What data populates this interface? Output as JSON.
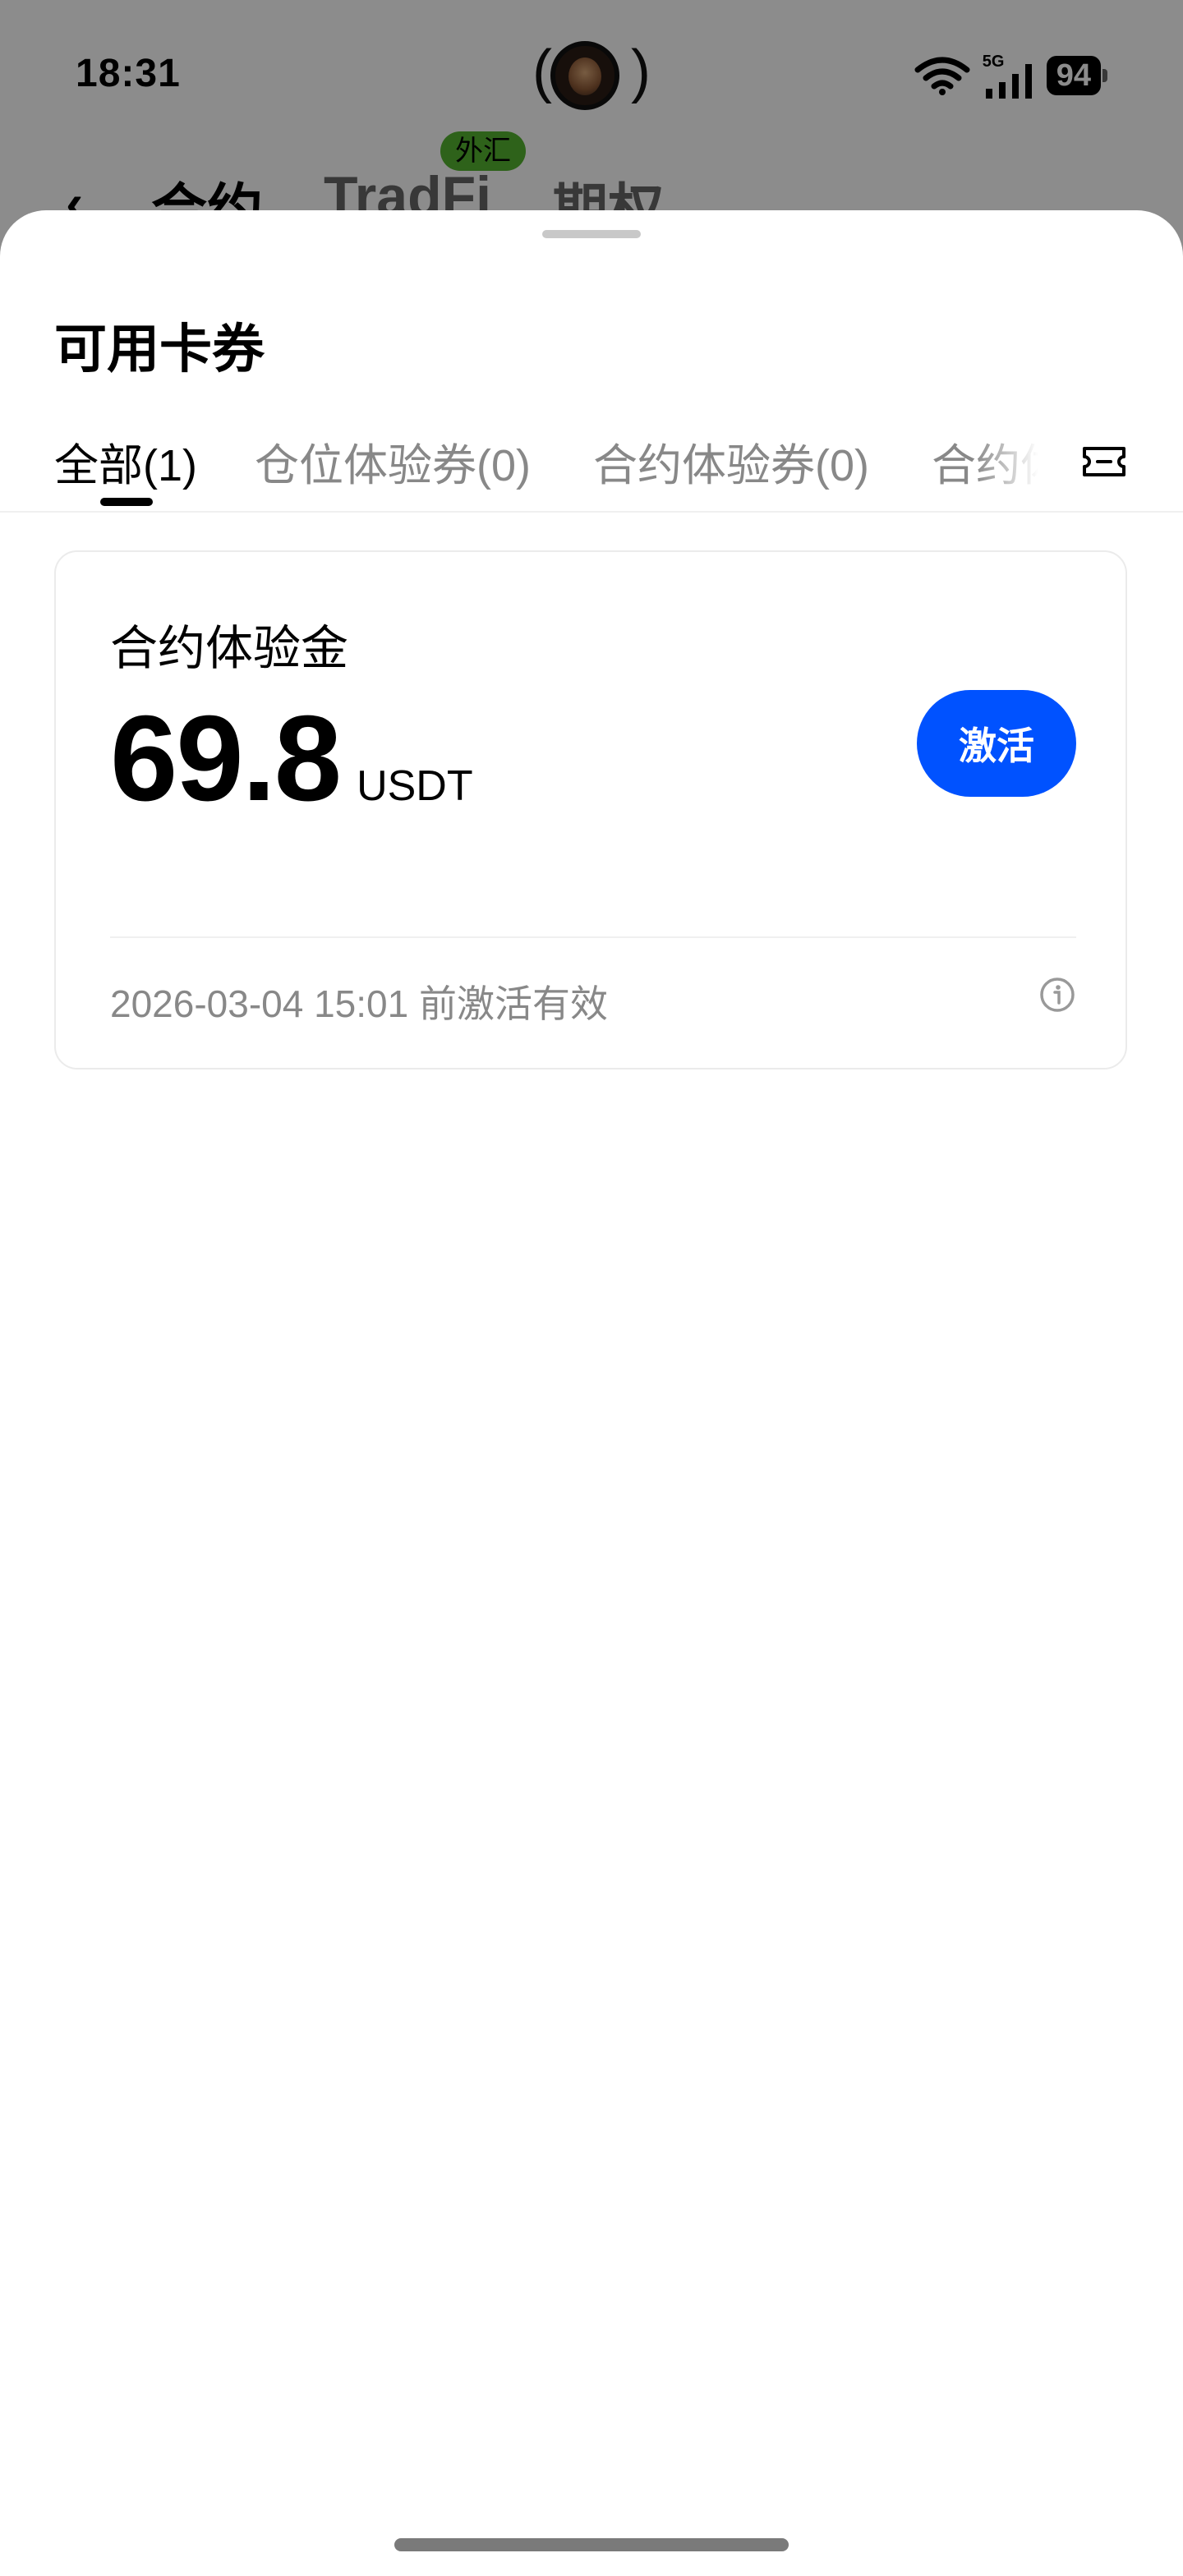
{
  "status_bar": {
    "time": "18:31",
    "network": "5G",
    "battery": "94"
  },
  "background_nav": {
    "tabs": [
      "合约",
      "TradFi",
      "期权"
    ],
    "badge": "外汇"
  },
  "sheet": {
    "title": "可用卡券",
    "tabs": [
      {
        "label": "全部(1)",
        "active": true
      },
      {
        "label": "仓位体验券(0)",
        "active": false
      },
      {
        "label": "合约体验券(0)",
        "active": false
      },
      {
        "label": "合约体",
        "active": false
      }
    ],
    "ticket_icon": "ticket-icon"
  },
  "card": {
    "title": "合约体验金",
    "amount": "69.8",
    "unit": "USDT",
    "button_label": "激活",
    "expiry": "2026-03-04 15:01 前激活有效",
    "info_icon": "info-icon"
  },
  "colors": {
    "accent": "#0052ff",
    "badge": "#55b230",
    "muted_text": "#888888",
    "overlay": "rgba(0,0,0,0.45)"
  }
}
